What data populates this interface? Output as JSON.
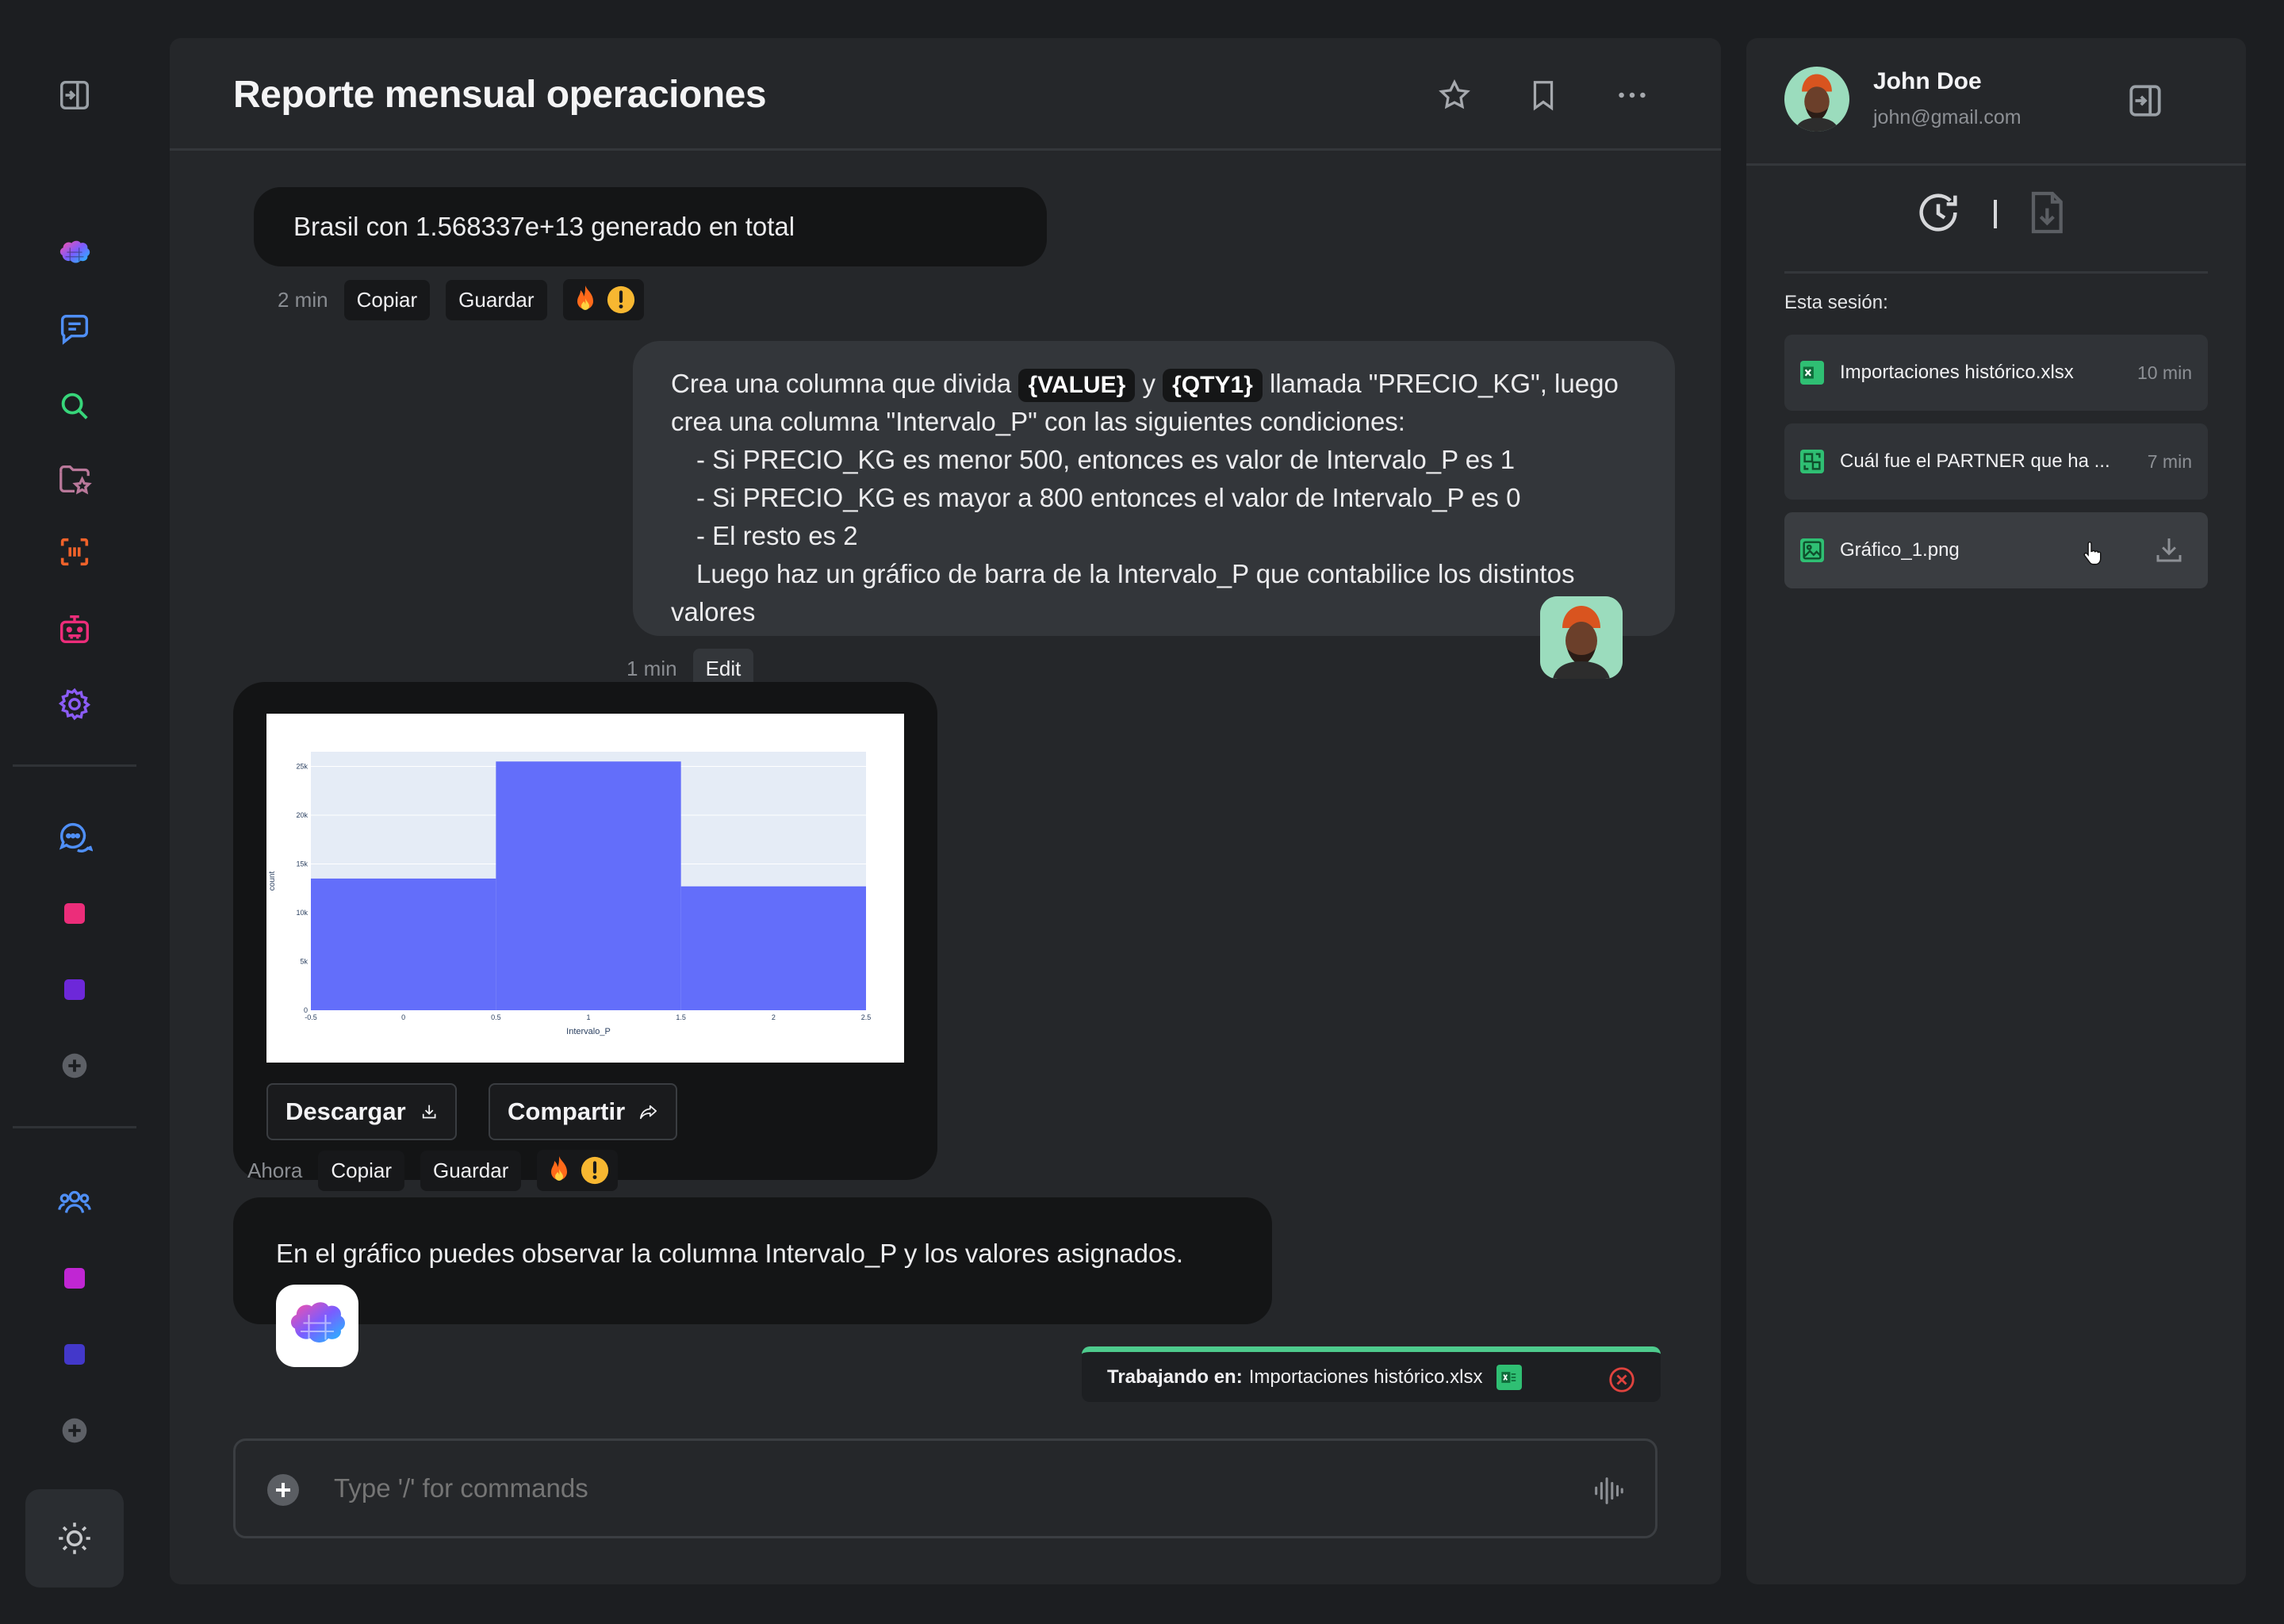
{
  "colors": {
    "accent_green": "#4ecb8d",
    "chart_bar": "#636efa",
    "chart_bg": "#e5ecf6",
    "pink": "#ec2d7a",
    "purple": "#6d28d9",
    "magenta": "#c026d3",
    "indigo": "#4338ca"
  },
  "rail": {
    "icons": [
      "collapse-icon",
      "brain-logo",
      "chat-icon",
      "search-icon",
      "folder-star-icon",
      "scan-icon",
      "robot-icon",
      "gear-icon",
      "chat-bubbles-icon",
      "plus-circle-icon",
      "team-icon",
      "sun-icon"
    ]
  },
  "header": {
    "title": "Reporte mensual operaciones",
    "icons": [
      "star-icon",
      "bookmark-icon",
      "more-icon"
    ]
  },
  "messages": {
    "m1": {
      "text": "Brasil con 1.568337e+13 generado en total",
      "time": "2 min",
      "copy": "Copiar",
      "save": "Guardar"
    },
    "m2": {
      "line1_a": "Crea una columna que divida",
      "chip1": "{VALUE}",
      "line1_b": "y",
      "chip2": "{QTY1}",
      "line1_c": "llamada \"PRECIO_KG\", luego",
      "line2": "crea una columna \"Intervalo_P\" con las siguientes condiciones:",
      "line3": "- Si PRECIO_KG es menor 500, entonces es valor de Intervalo_P es 1",
      "line4": "- Si PRECIO_KG es mayor a 800 entonces el valor de Intervalo_P es 0",
      "line5": "- El resto es 2",
      "line6": "Luego haz un gráfico de barra de la Intervalo_P que contabilice los distintos",
      "line7": "valores",
      "time": "1 min",
      "edit": "Edit"
    },
    "m3": {
      "download": "Descargar",
      "share": "Compartir",
      "time": "Ahora",
      "copy": "Copiar",
      "save": "Guardar"
    },
    "m4": {
      "text": "En el gráfico puedes observar la columna Intervalo_P y los valores asignados."
    }
  },
  "chart_data": {
    "type": "bar",
    "bins": [
      [
        -0.5,
        0.5
      ],
      [
        0.5,
        1.5
      ],
      [
        1.5,
        2.5
      ]
    ],
    "categories": [
      "0",
      "1",
      "2"
    ],
    "values": [
      13500,
      25500,
      12700
    ],
    "xlabel": "Intervalo_P",
    "ylabel": "count",
    "xlim": [
      -0.5,
      2.5
    ],
    "ylim": [
      0,
      26500
    ],
    "xticks": [
      "-0.5",
      "0",
      "0.5",
      "1",
      "1.5",
      "2",
      "2.5"
    ],
    "xtick_values": [
      -0.5,
      0,
      0.5,
      1,
      1.5,
      2,
      2.5
    ],
    "yticks": [
      "0",
      "5k",
      "10k",
      "15k",
      "20k",
      "25k"
    ],
    "ytick_values": [
      0,
      5000,
      10000,
      15000,
      20000,
      25000
    ],
    "grid": true
  },
  "working": {
    "label": "Trabajando en:",
    "file": "Importaciones histórico.xlsx"
  },
  "input": {
    "placeholder": "Type '/' for commands"
  },
  "user": {
    "name": "John Doe",
    "email": "john@gmail.com"
  },
  "side": {
    "session_label": "Esta sesión:",
    "files": [
      {
        "name": "Importaciones histórico.xlsx",
        "time": "10 min",
        "icon": "excel-icon"
      },
      {
        "name": "Cuál fue el PARTNER que ha ...",
        "time": "7 min",
        "icon": "table-icon"
      },
      {
        "name": "Gráfico_1.png",
        "time": "",
        "icon": "image-icon"
      }
    ]
  }
}
